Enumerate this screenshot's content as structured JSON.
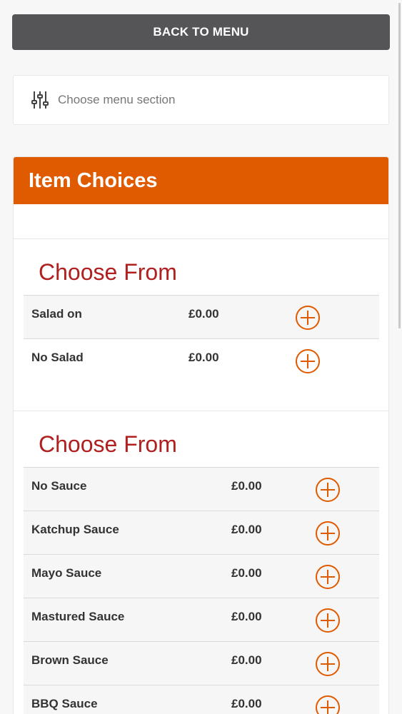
{
  "back_button": {
    "label": "BACK TO MENU"
  },
  "section_picker": {
    "icon": "sliders-icon",
    "label": "Choose menu section"
  },
  "panel": {
    "title": "Item Choices",
    "groups": [
      {
        "title": "Choose From",
        "items": [
          {
            "name": "Salad on",
            "price": "£0.00"
          },
          {
            "name": "No Salad",
            "price": "£0.00"
          }
        ]
      },
      {
        "title": "Choose From",
        "items": [
          {
            "name": "No Sauce",
            "price": "£0.00"
          },
          {
            "name": "Katchup Sauce",
            "price": "£0.00"
          },
          {
            "name": "Mayo Sauce",
            "price": "£0.00"
          },
          {
            "name": "Mastured Sauce",
            "price": "£0.00"
          },
          {
            "name": "Brown Sauce",
            "price": "£0.00"
          },
          {
            "name": "BBQ Sauce",
            "price": "£0.00"
          }
        ]
      }
    ]
  },
  "colors": {
    "accent": "#e05a00",
    "heading": "#b0201f",
    "button_bg": "#555457"
  }
}
